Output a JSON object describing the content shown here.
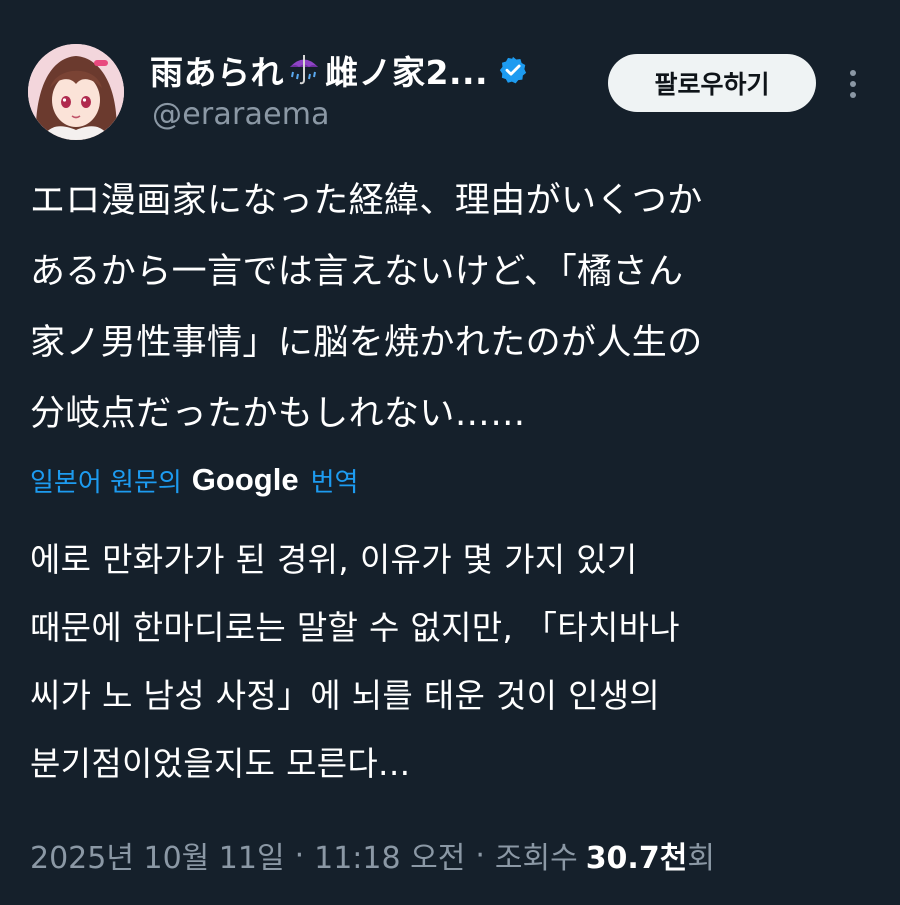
{
  "author": {
    "display_name_part1": "雨あられ",
    "display_name_part2": "雌ノ家2...",
    "handle": "@eraraema",
    "umbrella_icon": "umbrella-with-rain-icon",
    "verified_icon": "verified-badge-icon",
    "avatar_icon": "anime-girl-avatar"
  },
  "actions": {
    "follow_label": "팔로우하기",
    "more_icon": "vertical-ellipsis-icon"
  },
  "tweet": {
    "original_lines": [
      "エロ漫画家になった経緯、理由がいくつか",
      "あるから一言では言えないけど、「橘さん",
      "家ノ男性事情」に脳を焼かれたのが人生の",
      "分岐点だったかもしれない……"
    ],
    "translation_prefix": "일본어 원문의",
    "translation_brand": "Google",
    "translation_suffix": "번역",
    "translated_lines": [
      "에로 만화가가 된 경위, 이유가 몇 가지 있기",
      "때문에 한마디로는 말할 수 없지만, 「타치바나",
      "씨가 노 남성 사정」에 뇌를 태운 것이 인생의",
      "분기점이었을지도 모른다..."
    ]
  },
  "meta": {
    "date": "2025년 10월 11일",
    "separator": "·",
    "time": "11:18 오전",
    "views_label": "조회수",
    "views_count": "30.7천",
    "views_unit": "회"
  },
  "colors": {
    "background": "#15202b",
    "link": "#1d9bf0",
    "muted": "#8b98a5",
    "verified": "#1d9bf0"
  }
}
